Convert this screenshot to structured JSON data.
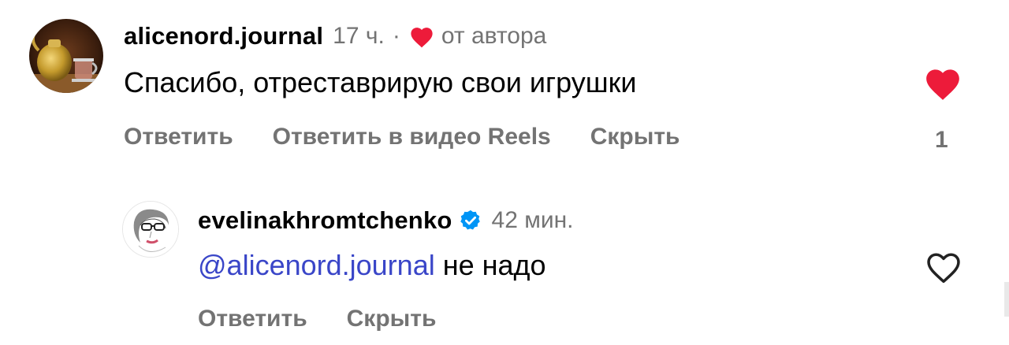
{
  "comments": [
    {
      "username": "alicenord.journal",
      "time": "17 ч.",
      "separator": "·",
      "author_badge": "от автора",
      "author_heart_icon": "heart-filled-icon",
      "text": "Спасибо, отреставрирую свои игрушки",
      "actions": [
        "Ответить",
        "Ответить в видео Reels",
        "Скрыть"
      ],
      "liked": true,
      "like_icon": "heart-filled-icon",
      "like_count": "1",
      "like_color": "#ed1b3a"
    },
    {
      "username": "evelinakhromtchenko",
      "verified_icon": "verified-badge-icon",
      "verified_color": "#0095f6",
      "time": "42 мин.",
      "mention": "@alicenord.journal",
      "text": " не надо",
      "actions": [
        "Ответить",
        "Скрыть"
      ],
      "liked": false,
      "like_icon": "heart-outline-icon"
    }
  ],
  "colors": {
    "secondary_text": "#737373",
    "mention": "#3a46c8",
    "like_red": "#ed1b3a"
  }
}
